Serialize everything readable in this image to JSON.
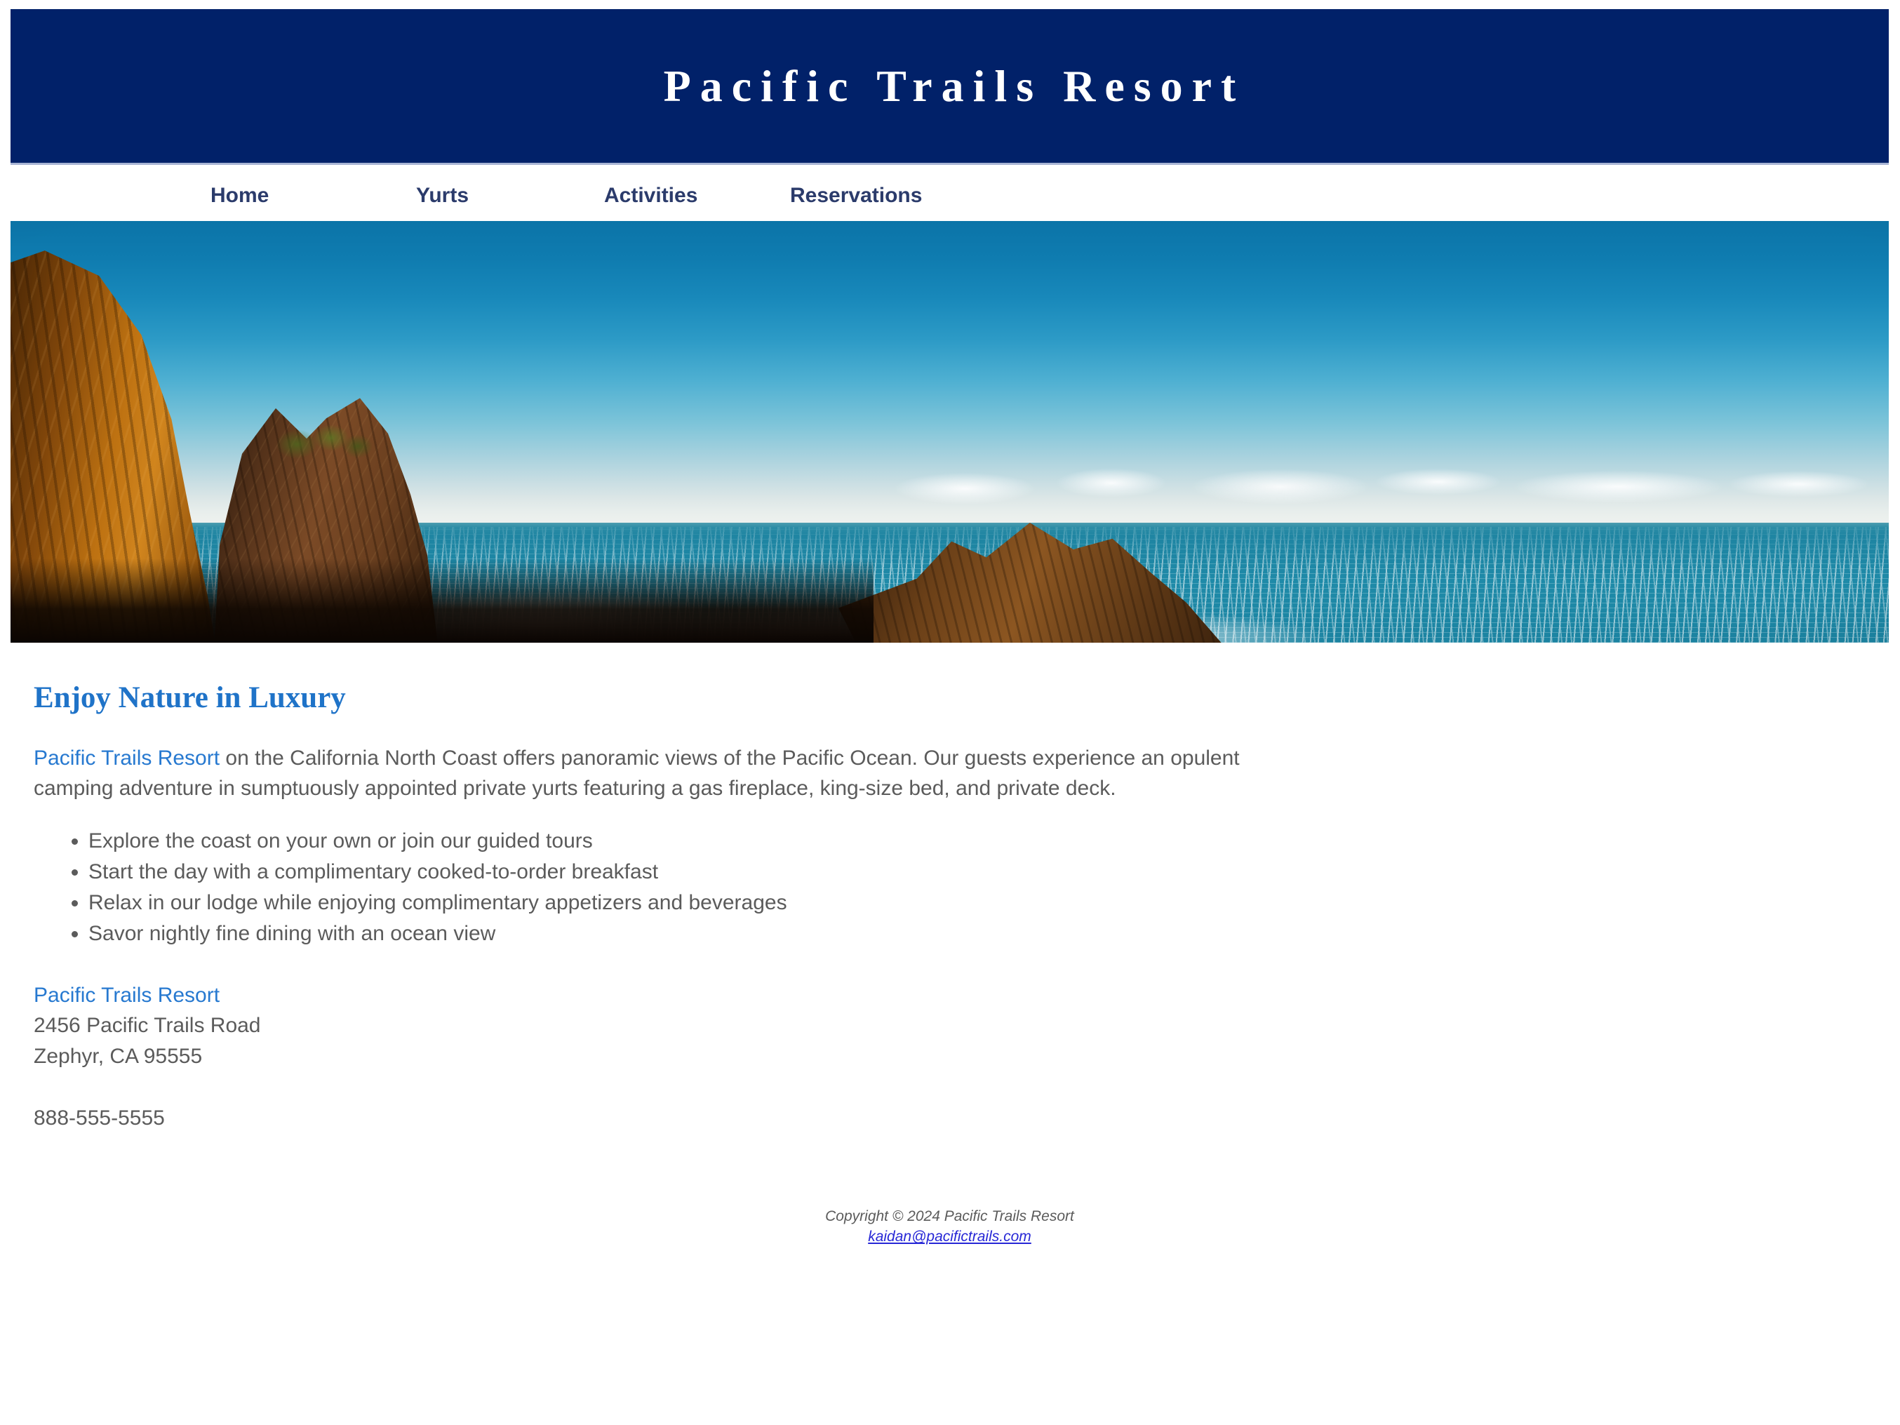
{
  "header": {
    "site_title": "Pacific Trails Resort",
    "background_color": "#012169",
    "title_color": "#ffffff"
  },
  "nav": {
    "items": [
      {
        "label": "Home"
      },
      {
        "label": "Yurts"
      },
      {
        "label": "Activities"
      },
      {
        "label": "Reservations"
      }
    ],
    "link_color": "#2b3b6b"
  },
  "hero": {
    "alt": "Rocky coastline with blue sky and the Pacific Ocean"
  },
  "main": {
    "heading": "Enjoy Nature in Luxury",
    "heading_color": "#1f73c8",
    "intro_link_text": "Pacific Trails Resort",
    "intro_rest": " on the California North Coast offers panoramic views of the Pacific Ocean. Our guests experience an opulent camping adventure in sumptuously appointed private yurts featuring a gas fireplace, king-size bed, and private deck.",
    "features": [
      "Explore the coast on your own or join our guided tours",
      "Start the day with a complimentary cooked-to-order breakfast",
      "Relax in our lodge while enjoying complimentary appetizers and beverages",
      "Savor nightly fine dining with an ocean view"
    ],
    "contact": {
      "name": "Pacific Trails Resort",
      "street": "2456 Pacific Trails Road",
      "city_state_zip": "Zephyr, CA 95555",
      "phone": "888-555-5555"
    }
  },
  "footer": {
    "copyright": "Copyright © 2024 Pacific Trails Resort",
    "email": "kaidan@pacifictrails.com",
    "email_color": "#2727d6"
  }
}
